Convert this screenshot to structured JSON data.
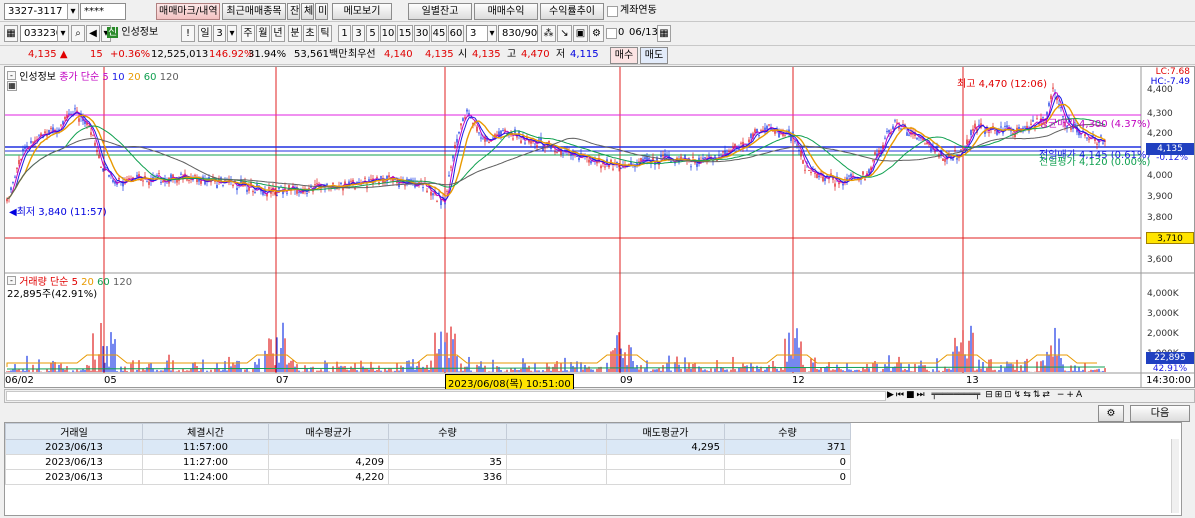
{
  "toolbar1": {
    "account": "3327-3117",
    "password": "****",
    "tab_active": "매매마크/내역 조회",
    "btn_recent": "최근매매종목",
    "btn_jan": "잔",
    "btn_che": "체",
    "btn_mi": "미",
    "btn_memo": "메모보기",
    "btn_daily": "일별잔고",
    "btn_profit": "매매수익",
    "btn_rate": "수익률추이",
    "chk_link": "계좌연동"
  },
  "toolbar2": {
    "code": "033230",
    "badge": "신",
    "name": "인성정보",
    "excl": "!",
    "day": "일",
    "day_n": "3",
    "week": "주",
    "month": "월",
    "year": "년",
    "minute": "분",
    "second": "초",
    "tick": "틱",
    "intervals": [
      "1",
      "3",
      "5",
      "10",
      "15",
      "30",
      "45",
      "60"
    ],
    "count": "3",
    "range": "830/900",
    "date_prefix": "0",
    "date": "06/13"
  },
  "quote": {
    "price": "4,135",
    "arrow": "▲",
    "change": "15",
    "change_pct": "+0.36%",
    "volume": "12,525,013",
    "vol_ratio": "146.92%",
    "turnover": "31.94%",
    "amount": "53,561백만",
    "best_ask_label": "최우선",
    "best_ask": "4,140",
    "best_bid": "4,135",
    "open_label": "시",
    "open": "4,135",
    "high_label": "고",
    "high": "4,470",
    "low_label": "저",
    "low": "4,115",
    "buy_btn": "매수",
    "sell_btn": "매도"
  },
  "price_panel": {
    "title": "인성정보",
    "ma_title": "종가 단순",
    "ma_periods": [
      "5",
      "10",
      "20",
      "60",
      "120"
    ],
    "ma_colors": [
      "#c000c0",
      "#1a1ae6",
      "#e89a00",
      "#10a050",
      "#606060"
    ],
    "high_note": "최고 4,470 (12:06)",
    "low_note": "최저 3,840 (11:57)",
    "avg_buy_note": "평균매가 4,300 (4.37%)",
    "avg_buy_line_note": "전일매가 4,145 (0.61%)",
    "avg_sell_note": "전일평가 4,120 (0.00%)",
    "lc": "LC:7.68",
    "hc": "HC:-7.49",
    "pct_right": "-0.12%",
    "current_tag": "4,135",
    "line_tag": "3,710",
    "y_ticks": [
      "4,400",
      "4,300",
      "4,200",
      "4,000",
      "3,900",
      "3,800",
      "3,600"
    ]
  },
  "volume_panel": {
    "title": "거래량",
    "ma_title": "단순",
    "ma_periods": [
      "5",
      "20",
      "60",
      "120"
    ],
    "ma_colors": [
      "#e00000",
      "#e89a00",
      "#10a050",
      "#606060"
    ],
    "current": "22,895주(42.91%)",
    "tag_value": "22,895",
    "tag_pct": "42.91%",
    "y_ticks": [
      "4,000K",
      "3,000K",
      "2,000K",
      "1,000K"
    ]
  },
  "x_axis": {
    "labels": [
      "06/02",
      "05",
      "07",
      "09",
      "12",
      "13"
    ],
    "cursor_label": "2023/06/08(목) 10:51:00",
    "end_time": "14:30:00"
  },
  "bottom_bar": {
    "next_btn": "다음"
  },
  "trades_table": {
    "headers": [
      "거래일",
      "체결시간",
      "매수평균가",
      "수량",
      "",
      "매도평균가",
      "수량"
    ],
    "rows": [
      [
        "2023/06/13",
        "11:57:00",
        "",
        "",
        "",
        "4,295",
        "371"
      ],
      [
        "2023/06/13",
        "11:27:00",
        "4,209",
        "35",
        "",
        "",
        "0"
      ],
      [
        "2023/06/13",
        "11:24:00",
        "4,220",
        "336",
        "",
        "",
        "0"
      ]
    ]
  }
}
